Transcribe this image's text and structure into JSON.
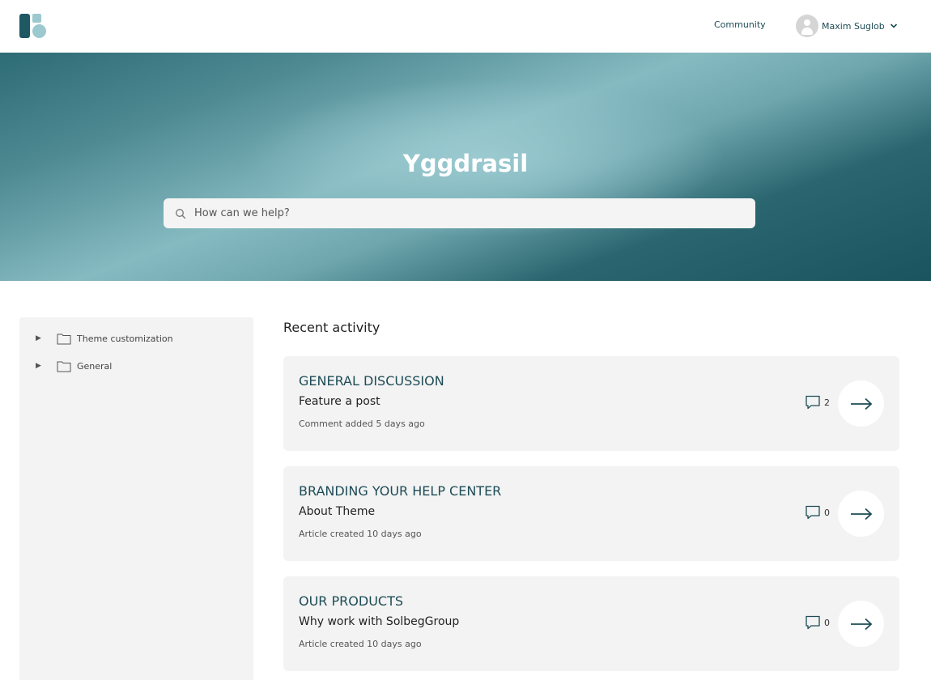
{
  "header": {
    "logo": "brand-logo",
    "community_label": "Community",
    "user_name": "Maxim Suglob"
  },
  "hero": {
    "title": "Yggdrasil",
    "search_placeholder": "How can we help?"
  },
  "sidebar": {
    "items": [
      {
        "label": "Theme customization"
      },
      {
        "label": "General"
      }
    ]
  },
  "recent": {
    "title": "Recent activity",
    "items": [
      {
        "category": "GENERAL DISCUSSION",
        "title": "Feature a post",
        "meta": "Comment added 5 days ago",
        "comments": "2"
      },
      {
        "category": "BRANDING YOUR HELP CENTER",
        "title": "About Theme",
        "meta": "Article created 10 days ago",
        "comments": "0"
      },
      {
        "category": "OUR PRODUCTS",
        "title": "Why work with SolbegGroup",
        "meta": "Article created 10 days ago",
        "comments": "0"
      }
    ]
  },
  "colors": {
    "brand": "#1d5863",
    "accent_light": "#9cc9cf",
    "link": "#1d4c56",
    "card_bg": "#f3f3f3"
  }
}
